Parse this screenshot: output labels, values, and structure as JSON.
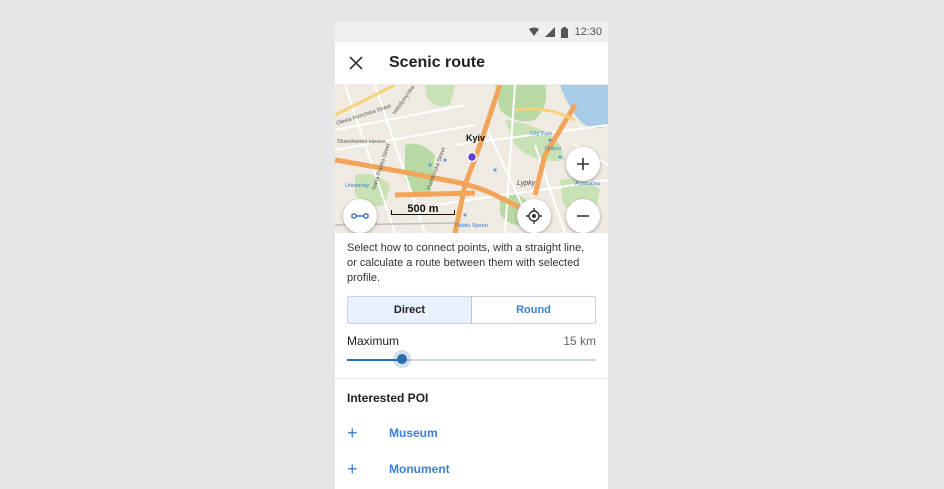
{
  "status_bar": {
    "time": "12:30",
    "icons": [
      "wifi-icon",
      "signal-icon",
      "battery-icon"
    ]
  },
  "toolbar": {
    "close_icon": "close-icon",
    "title": "Scenic route"
  },
  "map": {
    "city_label": "Kyiv",
    "scale_label": "500 m",
    "street_labels": [
      "Olesia Honchara Street",
      "Volodymyrska Street",
      "Pushkinska Street",
      "Ivana Franka Street",
      "Shevchenko square",
      "Lypky",
      "Arsenalna",
      "Palats Sportu",
      "University",
      "City Park",
      "Dnipro"
    ],
    "buttons": {
      "zoom_in": "plus-icon",
      "zoom_out": "minus-icon",
      "locate": "crosshair-icon",
      "route": "route-icon"
    },
    "colors": {
      "road_major": "#f2a55a",
      "park": "#b7d9a3",
      "water": "#a8cbe8",
      "location": "#5b3fd6"
    }
  },
  "description": "Select how to connect points, with a straight line, or calculate a route between them with selected profile.",
  "mode_toggle": {
    "options": [
      "Direct",
      "Round"
    ],
    "selected": "Direct"
  },
  "distance": {
    "label": "Maximum",
    "value_text": "15 km",
    "fraction": 0.22
  },
  "poi_section": {
    "title": "Interested POI",
    "items": [
      {
        "label": "Museum"
      },
      {
        "label": "Monument"
      }
    ]
  },
  "accent_color": "#3b7fd6"
}
